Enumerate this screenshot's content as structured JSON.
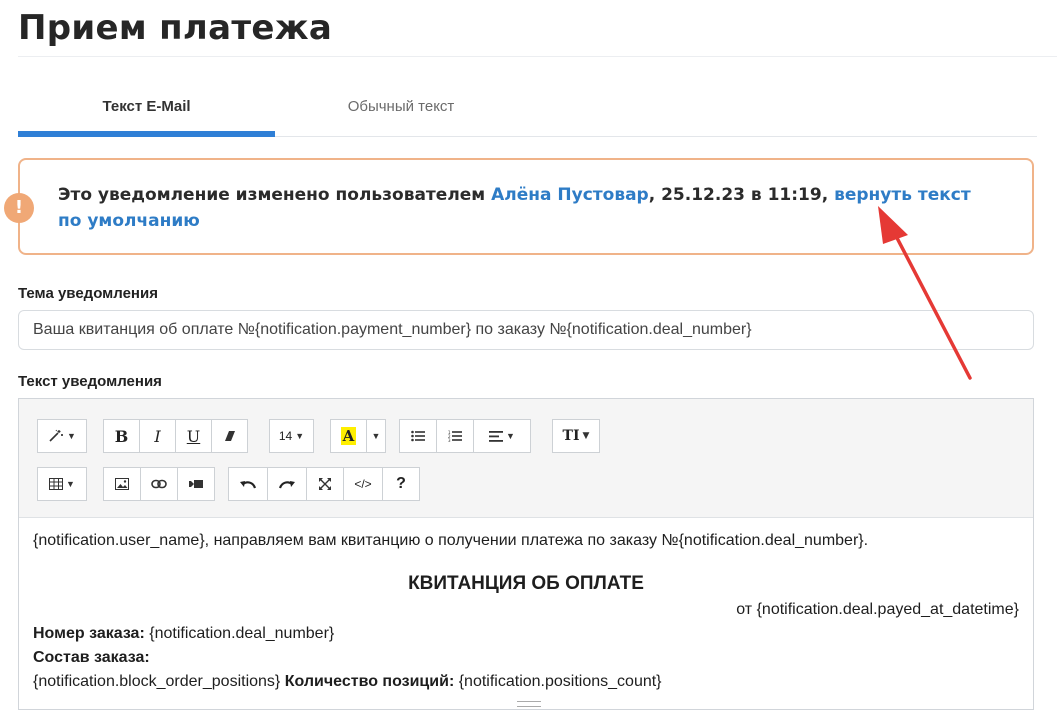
{
  "page": {
    "title": "Прием платежа"
  },
  "tabs": [
    {
      "label": "Текст E-Mail",
      "active": true
    },
    {
      "label": "Обычный текст",
      "active": false
    }
  ],
  "notice": {
    "icon": "!",
    "text_prefix": "Это уведомление изменено пользователем ",
    "user_link": "Алёна Пустовар",
    "text_middle": ", 25.12.23 в 11:19, ",
    "reset_link": "вернуть текст по умолчанию"
  },
  "subject": {
    "label": "Тема уведомления",
    "value": "Ваша квитанция об оплате №{notification.payment_number} по заказу №{notification.deal_number}"
  },
  "body": {
    "label": "Текст уведомления"
  },
  "toolbar": {
    "magic": "magic-wand-icon",
    "bold": "B",
    "italic": "I",
    "underline": "U",
    "eraser": "eraser-icon",
    "font_size": "14",
    "font_color": "A",
    "bullet_list": "unordered-list-icon",
    "ordered_list": "ordered-list-icon",
    "align": "align-icon",
    "text_height": "TI",
    "table": "table-icon",
    "image": "image-icon",
    "link": "link-icon",
    "video": "video-icon",
    "undo": "undo-icon",
    "redo": "redo-icon",
    "fullscreen": "fullscreen-icon",
    "code": "</>",
    "help": "?"
  },
  "editor": {
    "line1": "{notification.user_name}, направляем вам квитанцию о получении платежа по заказу №{notification.deal_number}.",
    "heading": "КВИТАНЦИЯ ОБ ОПЛАТЕ",
    "date_line": "от {notification.deal.payed_at_datetime}",
    "order_label": "Номер заказа:",
    "order_value": " {notification.deal_number}",
    "composition_label": "Состав заказа:",
    "positions_value": "{notification.block_order_positions} ",
    "count_label": "Количество позиций:",
    "count_value": " {notification.positions_count}"
  },
  "colors": {
    "accent": "#2f7fd6",
    "link": "#2e7cc6",
    "warning_border": "#f0b389",
    "warning_icon": "#f0a876",
    "arrow": "#e53935"
  }
}
